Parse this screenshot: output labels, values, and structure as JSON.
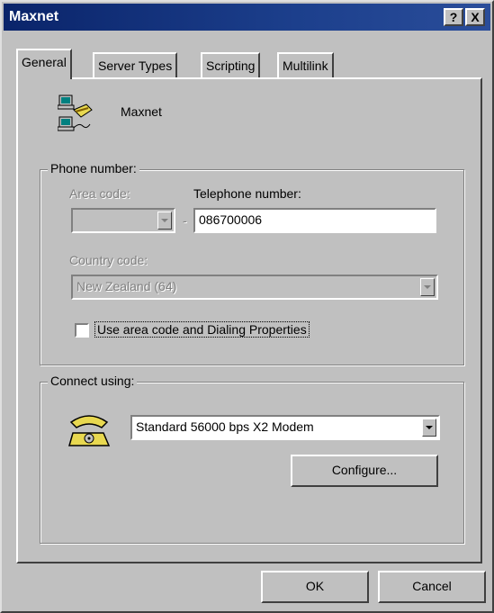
{
  "window": {
    "title": "Maxnet",
    "help_button": "?",
    "close_button": "X"
  },
  "tabs": [
    {
      "label": "General",
      "active": true
    },
    {
      "label": "Server Types",
      "active": false
    },
    {
      "label": "Scripting",
      "active": false
    },
    {
      "label": "Multilink",
      "active": false
    }
  ],
  "connection": {
    "name": "Maxnet",
    "icon": "dial-up-connection-icon"
  },
  "phone_number": {
    "group_label": "Phone number:",
    "area_code_label": "Area code:",
    "area_code_value": "",
    "separator": "-",
    "telephone_label": "Telephone number:",
    "telephone_value": "086700006",
    "country_code_label": "Country code:",
    "country_code_value": "New Zealand (64)",
    "use_area_code_label": "Use area code and Dialing Properties",
    "use_area_code_checked": false
  },
  "connect_using": {
    "group_label": "Connect using:",
    "modem_icon": "telephone-modem-icon",
    "modem_value": "Standard 56000 bps X2 Modem",
    "configure_label": "Configure..."
  },
  "buttons": {
    "ok": "OK",
    "cancel": "Cancel"
  },
  "colors": {
    "titlebar": "#0a246a",
    "face": "#c0c0c0"
  }
}
